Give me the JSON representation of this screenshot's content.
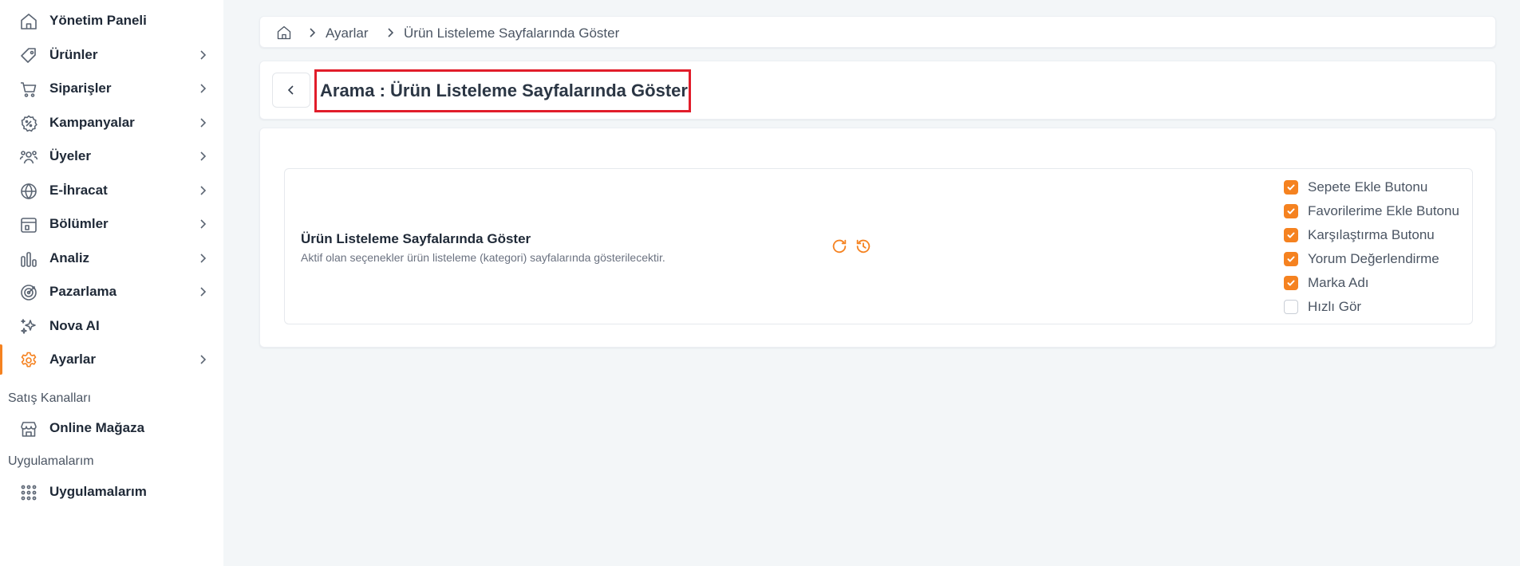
{
  "sidebar": {
    "items": [
      {
        "label": "Yönetim Paneli"
      },
      {
        "label": "Ürünler"
      },
      {
        "label": "Siparişler"
      },
      {
        "label": "Kampanyalar"
      },
      {
        "label": "Üyeler"
      },
      {
        "label": "E-İhracat"
      },
      {
        "label": "Bölümler"
      },
      {
        "label": "Analiz"
      },
      {
        "label": "Pazarlama"
      },
      {
        "label": "Nova AI"
      },
      {
        "label": "Ayarlar"
      }
    ],
    "sales_channels_title": "Satış Kanalları",
    "online_store": "Online Mağaza",
    "apps_title": "Uygulamalarım",
    "apps_item": "Uygulamalarım",
    "accent_color": "#f58220"
  },
  "breadcrumb": {
    "level1": "Ayarlar",
    "level2": "Ürün Listeleme Sayfalarında Göster"
  },
  "header": {
    "title": "Arama : Ürün Listeleme Sayfalarında Göster"
  },
  "setting": {
    "title": "Ürün Listeleme Sayfalarında Göster",
    "description": "Aktif olan seçenekler ürün listeleme (kategori) sayfalarında gösterilecektir.",
    "options": [
      {
        "label": "Sepete Ekle Butonu",
        "checked": true
      },
      {
        "label": "Favorilerime Ekle Butonu",
        "checked": true
      },
      {
        "label": "Karşılaştırma Butonu",
        "checked": true
      },
      {
        "label": "Yorum Değerlendirme",
        "checked": true
      },
      {
        "label": "Marka Adı",
        "checked": true
      },
      {
        "label": "Hızlı Gör",
        "checked": false
      }
    ]
  }
}
